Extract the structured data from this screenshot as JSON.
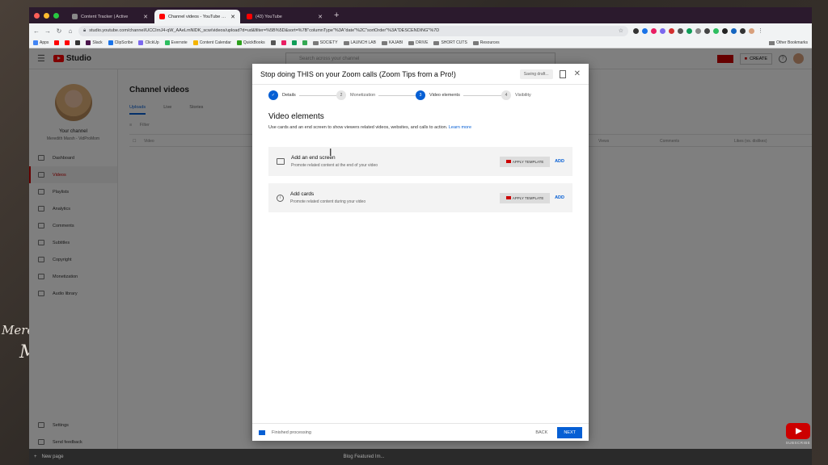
{
  "browser": {
    "tabs": [
      {
        "title": "Content Tracker | Active",
        "color": "#888888"
      },
      {
        "title": "Channel videos - YouTube Stu...",
        "color": "#ff0000",
        "active": true
      },
      {
        "title": "(43) YouTube",
        "color": "#ff0000"
      }
    ],
    "new_tab": "+",
    "url": "studio.youtube.com/channel/UCCIrnJ4-qW_AAeLmNlDK_scw/videos/upload?d=ud&filter=%5B%5D&sort=%7B\"columnType\"%3A\"date\"%2C\"sortOrder\"%3A\"DESCENDING\"%7D",
    "bookmarks": [
      {
        "label": "Apps",
        "color": "#4285f4"
      },
      {
        "label": "",
        "color": "#ff0000"
      },
      {
        "label": "",
        "color": "#ff0000"
      },
      {
        "label": "",
        "color": "#333333"
      },
      {
        "label": "Slack",
        "color": "#4a154b"
      },
      {
        "label": "ClipScribe",
        "color": "#1a73e8"
      },
      {
        "label": "ClickUp",
        "color": "#7b68ee"
      },
      {
        "label": "Evernote",
        "color": "#2dbe60"
      },
      {
        "label": "Content Calendar",
        "color": "#f4b400"
      },
      {
        "label": "QuickBooks",
        "color": "#2ca01c"
      },
      {
        "label": "",
        "color": "#555555"
      },
      {
        "label": "",
        "color": "#e91e63"
      },
      {
        "label": "",
        "color": "#0f9d58"
      },
      {
        "label": "",
        "color": "#34a853"
      },
      {
        "label": "SOCIETY",
        "color": "folder"
      },
      {
        "label": "LAUNCH LAB",
        "color": "folder"
      },
      {
        "label": "KAJABI",
        "color": "folder"
      },
      {
        "label": "DRIVE",
        "color": "folder"
      },
      {
        "label": "SHORT CUTS",
        "color": "folder"
      },
      {
        "label": "Resources",
        "color": "folder"
      }
    ],
    "other_bookmarks": "Other Bookmarks"
  },
  "studio": {
    "logo_text": "Studio",
    "search_placeholder": "Search across your channel",
    "create_label": "CREATE",
    "sidebar": {
      "your_channel": "Your channel",
      "channel_name": "Meredith Marsh - VidProMom",
      "items": [
        {
          "label": "Dashboard"
        },
        {
          "label": "Videos",
          "active": true
        },
        {
          "label": "Playlists"
        },
        {
          "label": "Analytics"
        },
        {
          "label": "Comments"
        },
        {
          "label": "Subtitles"
        },
        {
          "label": "Copyright"
        },
        {
          "label": "Monetization"
        },
        {
          "label": "Audio library"
        }
      ],
      "bottom_items": [
        {
          "label": "Settings"
        },
        {
          "label": "Send feedback"
        }
      ]
    },
    "main": {
      "title": "Channel videos",
      "tabs": [
        "Uploads",
        "Live",
        "Stories"
      ],
      "filter": "Filter",
      "columns": [
        "Video",
        "Views",
        "Comments",
        "Likes (vs. dislikes)"
      ]
    }
  },
  "modal": {
    "title": "Stop doing THIS on your Zoom calls (Zoom Tips from a Pro!)",
    "saving": "Saving draft...",
    "steps": [
      {
        "num": "✓",
        "label": "Details",
        "state": "done"
      },
      {
        "num": "2",
        "label": "Monetization",
        "state": "todo"
      },
      {
        "num": "3",
        "label": "Video elements",
        "state": "cur"
      },
      {
        "num": "4",
        "label": "Visibility",
        "state": "todo"
      }
    ],
    "section_title": "Video elements",
    "section_desc": "Use cards and an end screen to show viewers related videos, websites, and calls to action.",
    "learn_more": "Learn more",
    "cards": [
      {
        "title": "Add an end screen",
        "desc": "Promote related content at the end of your video",
        "apply": "APPLY TEMPLATE",
        "add": "ADD"
      },
      {
        "title": "Add cards",
        "desc": "Promote related content during your video",
        "apply": "APPLY TEMPLATE",
        "add": "ADD"
      }
    ],
    "footer": {
      "status": "Finished processing",
      "back": "BACK",
      "next": "NEXT"
    }
  },
  "overlay": {
    "left_text_line1": "Mered",
    "left_text_line2": "M",
    "subscribe": "SUBSCRIBE",
    "bottom_left": "New page",
    "bottom_center": "Blog Featured Im..."
  },
  "colors": {
    "accent_blue": "#065fd4",
    "youtube_red": "#ff0000"
  }
}
